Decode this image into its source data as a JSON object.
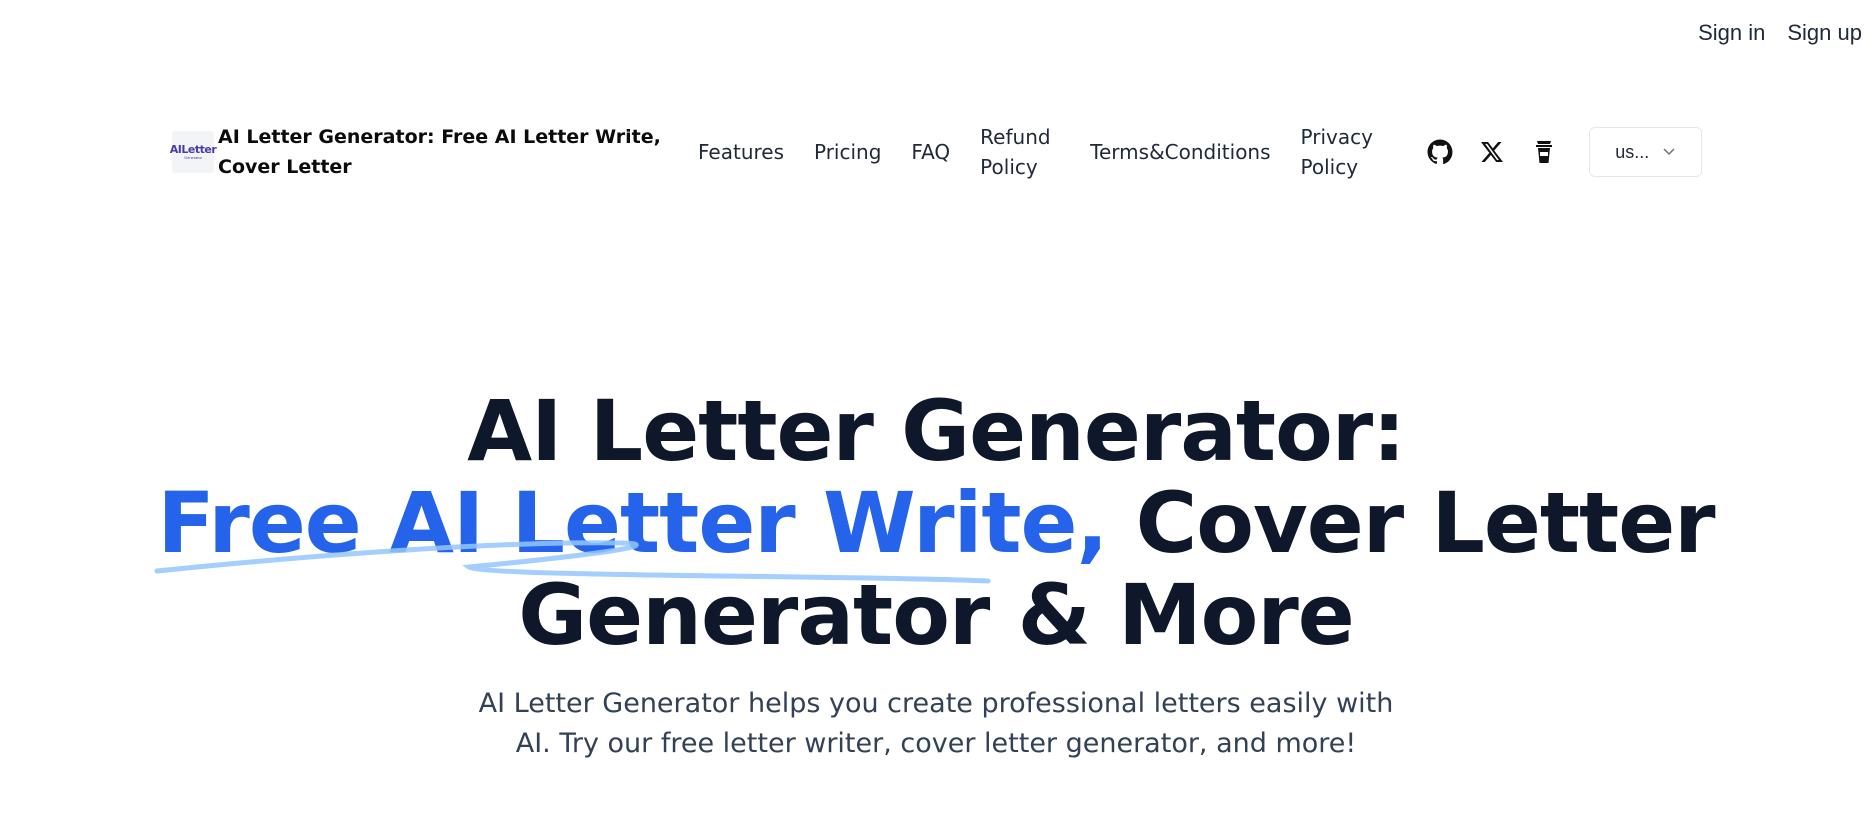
{
  "auth": {
    "sign_in": "Sign in",
    "sign_up": "Sign up"
  },
  "brand": {
    "logo_text": "AILetter",
    "logo_sub": "Generator",
    "title": "AI Letter Generator: Free AI Letter Write, Cover Letter"
  },
  "nav": {
    "features": "Features",
    "pricing": "Pricing",
    "faq": "FAQ",
    "refund": "Refund Policy",
    "terms": "Terms&Conditions",
    "privacy": "Privacy Policy"
  },
  "icons": [
    "github-icon",
    "x-icon",
    "coffee-icon"
  ],
  "language": {
    "selected": "us..."
  },
  "hero": {
    "line1": "AI Letter Generator:",
    "highlight": "Free AI Letter Write,",
    "line2_rest": " Cover Letter",
    "line3": "Generator & More",
    "subtitle_line1": "AI Letter Generator helps you create professional letters easily with",
    "subtitle_line2": "AI. Try our free letter writer, cover letter generator, and more!"
  },
  "colors": {
    "accent": "#2563eb",
    "heading": "#0f172a",
    "scribble": "#93c5fd"
  }
}
